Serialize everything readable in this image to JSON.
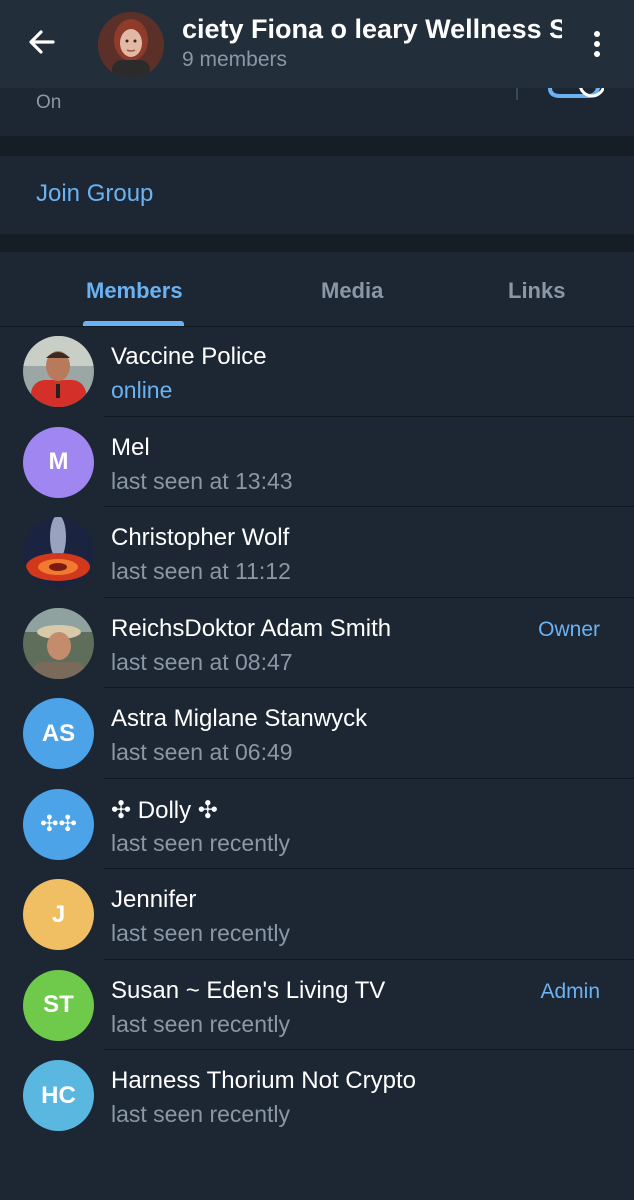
{
  "header": {
    "title": "ciety    Fiona o leary Wellness Society",
    "subtitle": "9 members"
  },
  "notifications": {
    "value": "On"
  },
  "join": {
    "label": "Join Group"
  },
  "tabs": [
    {
      "label": "Members",
      "active": true
    },
    {
      "label": "Media",
      "active": false
    },
    {
      "label": "Links",
      "active": false
    }
  ],
  "members": [
    {
      "name": "Vaccine Police",
      "status": "online",
      "role": "",
      "initials": "",
      "avatar_color": "#b8473c"
    },
    {
      "name": "Mel",
      "status": "last seen at 13:43",
      "role": "",
      "initials": "M",
      "avatar_color": "#9f86f0"
    },
    {
      "name": "Christopher Wolf",
      "status": "last seen at 11:12",
      "role": "",
      "initials": "",
      "avatar_color": "#1c2b4a"
    },
    {
      "name": "ReichsDoktor Adam Smith",
      "status": "last seen at 08:47",
      "role": "Owner",
      "initials": "",
      "avatar_color": "#6b6a55"
    },
    {
      "name": "Astra Miglane Stanwyck",
      "status": "last seen at 06:49",
      "role": "",
      "initials": "AS",
      "avatar_color": "#4da3e8"
    },
    {
      "name": "✣ Dolly ✣",
      "status": "last seen recently",
      "role": "",
      "initials": "✣✣",
      "avatar_color": "#4da3e8"
    },
    {
      "name": "Jennifer",
      "status": "last seen recently",
      "role": "",
      "initials": "J",
      "avatar_color": "#f0bf63"
    },
    {
      "name": "Susan ~ Eden's Living TV",
      "status": "last seen recently",
      "role": "Admin",
      "initials": "ST",
      "avatar_color": "#6fc94b"
    },
    {
      "name": "Harness Thorium Not Crypto",
      "status": "last seen recently",
      "role": "",
      "initials": "HC",
      "avatar_color": "#5ab8e0"
    }
  ],
  "colors": {
    "accent": "#6ab2f2",
    "background": "#1d2733",
    "header": "#222e3a",
    "secondary_text": "#8a97a5"
  }
}
